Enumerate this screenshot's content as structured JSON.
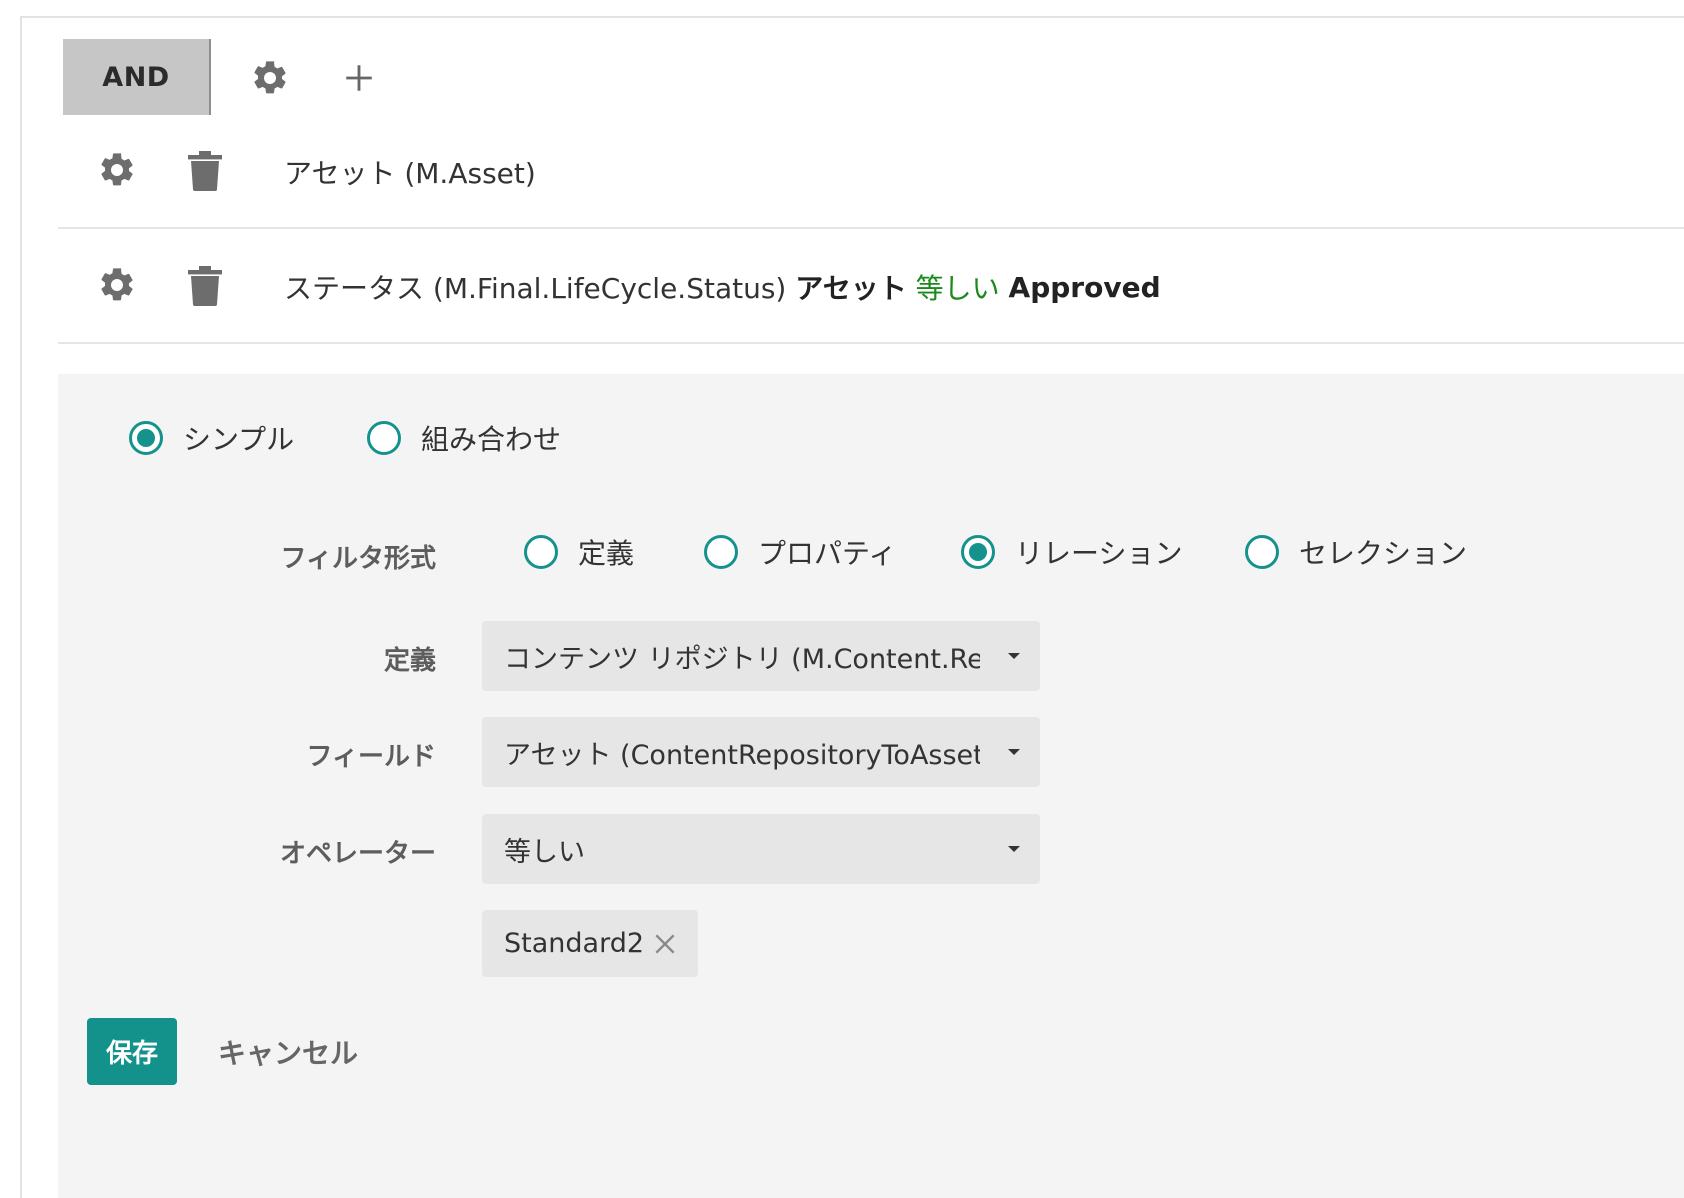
{
  "toolbar": {
    "and_label": "AND",
    "settings_icon": "gear-icon",
    "add_icon": "plus-icon"
  },
  "filters": [
    {
      "entity": "アセット (M.Asset)",
      "icons": [
        "gear-icon",
        "trash-icon"
      ]
    },
    {
      "entity": "ステータス (M.Final.LifeCycle.Status)",
      "relation": "アセット",
      "operator": "等しい",
      "value": "Approved",
      "icons": [
        "gear-icon",
        "trash-icon"
      ]
    }
  ],
  "editor": {
    "mode_options": [
      {
        "label": "シンプル",
        "selected": true
      },
      {
        "label": "組み合わせ",
        "selected": false
      }
    ],
    "filter_type_label": "フィルタ形式",
    "filter_type_options": [
      {
        "label": "定義",
        "selected": false
      },
      {
        "label": "プロパティ",
        "selected": false
      },
      {
        "label": "リレーション",
        "selected": true
      },
      {
        "label": "セレクション",
        "selected": false
      }
    ],
    "definition_label": "定義",
    "definition_value": "コンテンツ リポジトリ (M.Content.Reposi",
    "field_label": "フィールド",
    "field_value": "アセット (ContentRepositoryToAsset)",
    "operator_label": "オペレーター",
    "operator_value": "等しい",
    "chip_value": "Standard2",
    "save_label": "保存",
    "cancel_label": "キャンセル"
  },
  "colors": {
    "accent": "#13928c",
    "operator_green": "#1a8a1a",
    "and_button_bg": "#c6c6c6",
    "editor_bg": "#f4f4f4"
  }
}
